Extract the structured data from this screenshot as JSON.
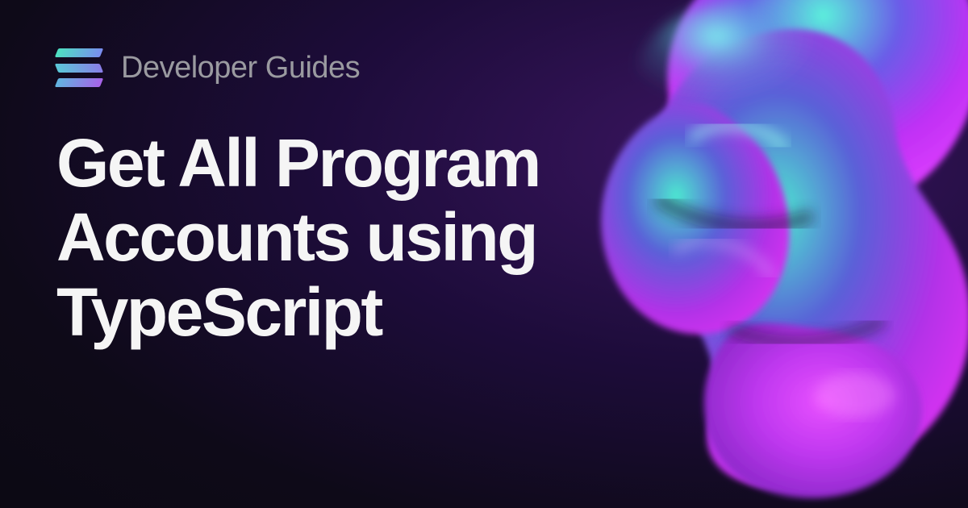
{
  "header": {
    "category": "Developer Guides"
  },
  "main": {
    "title": "Get All Program Accounts using TypeScript"
  },
  "colors": {
    "bg_dark": "#0a0810",
    "bg_purple": "#3a1560",
    "text_muted": "#9a9aa0",
    "text_primary": "#f5f5f5",
    "gradient_teal": "#4de0c0",
    "gradient_purple": "#a862e8",
    "blob_magenta": "#d835ff",
    "blob_cyan": "#3deed8",
    "blob_violet": "#7b3fe4"
  }
}
